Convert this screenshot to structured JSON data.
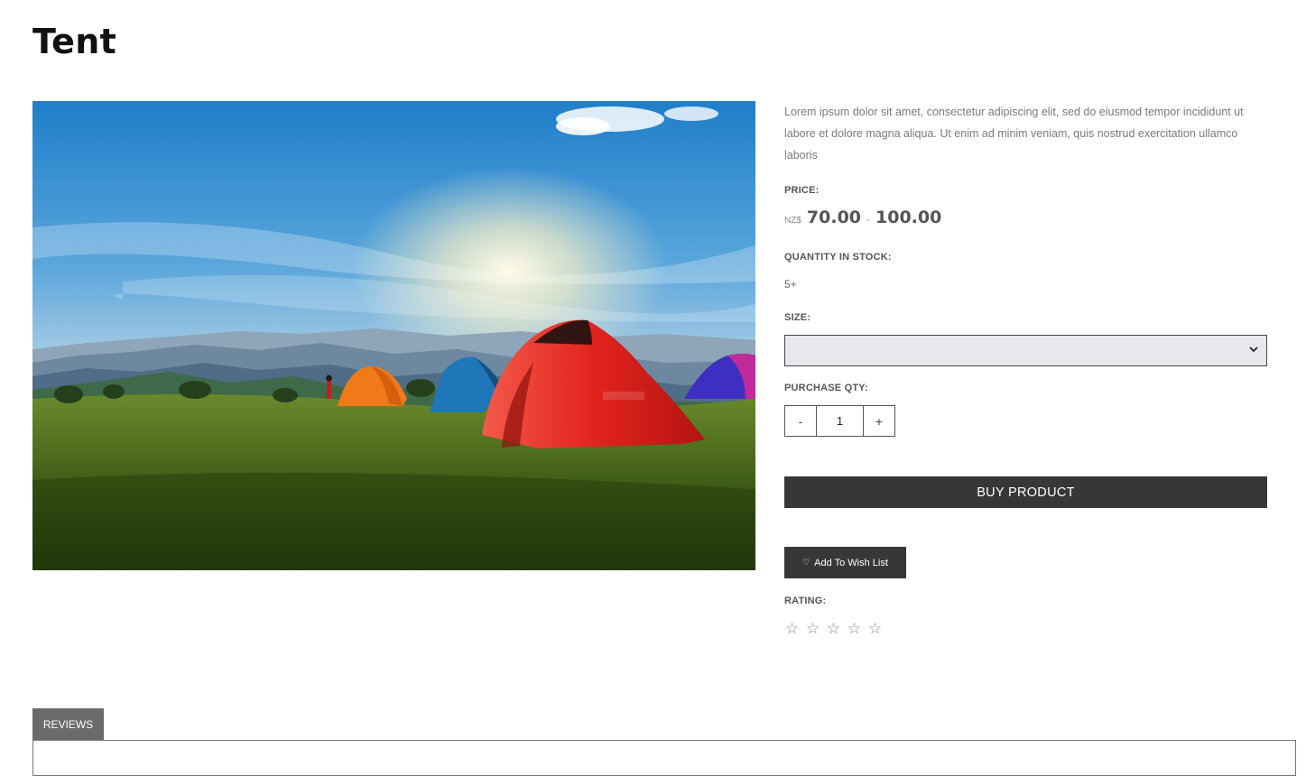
{
  "product": {
    "title": "Tent",
    "image_icon": "camping-tents-photo",
    "description": "Lorem ipsum dolor sit amet, consectetur adipiscing elit, sed do eiusmod tempor incididunt ut labore et dolore magna aliqua. Ut enim ad minim veniam, quis nostrud exercitation ullamco laboris"
  },
  "price": {
    "label": "PRICE:",
    "currency": "NZ$",
    "min": "70.00",
    "separator": "-",
    "max": "100.00"
  },
  "stock": {
    "label": "QUANTITY IN STOCK:",
    "value": "5+"
  },
  "size": {
    "label": "SIZE:",
    "selected": ""
  },
  "purchase_qty": {
    "label": "PURCHASE QTY:",
    "decrement": "-",
    "value": "1",
    "increment": "+"
  },
  "actions": {
    "buy": "BUY PRODUCT",
    "wish_icon": "heart-icon",
    "wish_symbol": "♡",
    "wish": "Add To Wish List"
  },
  "rating": {
    "label": "RATING:",
    "value": 0,
    "max": 5,
    "stars": [
      "☆",
      "☆",
      "☆",
      "☆",
      "☆"
    ]
  },
  "tabs": [
    {
      "label": "REVIEWS",
      "active": true
    }
  ],
  "colors": {
    "button_bg": "#373737",
    "tab_bg": "#6b6b6b",
    "select_bg": "#e8e8ec"
  }
}
